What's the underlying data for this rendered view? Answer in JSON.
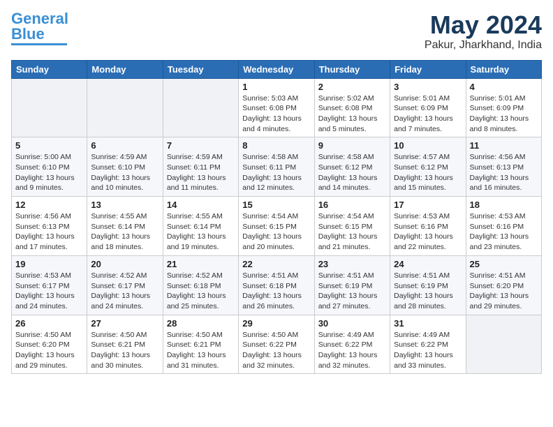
{
  "logo": {
    "line1": "General",
    "line2": "Blue"
  },
  "title": {
    "month_year": "May 2024",
    "location": "Pakur, Jharkhand, India"
  },
  "weekdays": [
    "Sunday",
    "Monday",
    "Tuesday",
    "Wednesday",
    "Thursday",
    "Friday",
    "Saturday"
  ],
  "weeks": [
    [
      {
        "day": "",
        "sunrise": "",
        "sunset": "",
        "daylight": ""
      },
      {
        "day": "",
        "sunrise": "",
        "sunset": "",
        "daylight": ""
      },
      {
        "day": "",
        "sunrise": "",
        "sunset": "",
        "daylight": ""
      },
      {
        "day": "1",
        "sunrise": "Sunrise: 5:03 AM",
        "sunset": "Sunset: 6:08 PM",
        "daylight": "Daylight: 13 hours and 4 minutes."
      },
      {
        "day": "2",
        "sunrise": "Sunrise: 5:02 AM",
        "sunset": "Sunset: 6:08 PM",
        "daylight": "Daylight: 13 hours and 5 minutes."
      },
      {
        "day": "3",
        "sunrise": "Sunrise: 5:01 AM",
        "sunset": "Sunset: 6:09 PM",
        "daylight": "Daylight: 13 hours and 7 minutes."
      },
      {
        "day": "4",
        "sunrise": "Sunrise: 5:01 AM",
        "sunset": "Sunset: 6:09 PM",
        "daylight": "Daylight: 13 hours and 8 minutes."
      }
    ],
    [
      {
        "day": "5",
        "sunrise": "Sunrise: 5:00 AM",
        "sunset": "Sunset: 6:10 PM",
        "daylight": "Daylight: 13 hours and 9 minutes."
      },
      {
        "day": "6",
        "sunrise": "Sunrise: 4:59 AM",
        "sunset": "Sunset: 6:10 PM",
        "daylight": "Daylight: 13 hours and 10 minutes."
      },
      {
        "day": "7",
        "sunrise": "Sunrise: 4:59 AM",
        "sunset": "Sunset: 6:11 PM",
        "daylight": "Daylight: 13 hours and 11 minutes."
      },
      {
        "day": "8",
        "sunrise": "Sunrise: 4:58 AM",
        "sunset": "Sunset: 6:11 PM",
        "daylight": "Daylight: 13 hours and 12 minutes."
      },
      {
        "day": "9",
        "sunrise": "Sunrise: 4:58 AM",
        "sunset": "Sunset: 6:12 PM",
        "daylight": "Daylight: 13 hours and 14 minutes."
      },
      {
        "day": "10",
        "sunrise": "Sunrise: 4:57 AM",
        "sunset": "Sunset: 6:12 PM",
        "daylight": "Daylight: 13 hours and 15 minutes."
      },
      {
        "day": "11",
        "sunrise": "Sunrise: 4:56 AM",
        "sunset": "Sunset: 6:13 PM",
        "daylight": "Daylight: 13 hours and 16 minutes."
      }
    ],
    [
      {
        "day": "12",
        "sunrise": "Sunrise: 4:56 AM",
        "sunset": "Sunset: 6:13 PM",
        "daylight": "Daylight: 13 hours and 17 minutes."
      },
      {
        "day": "13",
        "sunrise": "Sunrise: 4:55 AM",
        "sunset": "Sunset: 6:14 PM",
        "daylight": "Daylight: 13 hours and 18 minutes."
      },
      {
        "day": "14",
        "sunrise": "Sunrise: 4:55 AM",
        "sunset": "Sunset: 6:14 PM",
        "daylight": "Daylight: 13 hours and 19 minutes."
      },
      {
        "day": "15",
        "sunrise": "Sunrise: 4:54 AM",
        "sunset": "Sunset: 6:15 PM",
        "daylight": "Daylight: 13 hours and 20 minutes."
      },
      {
        "day": "16",
        "sunrise": "Sunrise: 4:54 AM",
        "sunset": "Sunset: 6:15 PM",
        "daylight": "Daylight: 13 hours and 21 minutes."
      },
      {
        "day": "17",
        "sunrise": "Sunrise: 4:53 AM",
        "sunset": "Sunset: 6:16 PM",
        "daylight": "Daylight: 13 hours and 22 minutes."
      },
      {
        "day": "18",
        "sunrise": "Sunrise: 4:53 AM",
        "sunset": "Sunset: 6:16 PM",
        "daylight": "Daylight: 13 hours and 23 minutes."
      }
    ],
    [
      {
        "day": "19",
        "sunrise": "Sunrise: 4:53 AM",
        "sunset": "Sunset: 6:17 PM",
        "daylight": "Daylight: 13 hours and 24 minutes."
      },
      {
        "day": "20",
        "sunrise": "Sunrise: 4:52 AM",
        "sunset": "Sunset: 6:17 PM",
        "daylight": "Daylight: 13 hours and 24 minutes."
      },
      {
        "day": "21",
        "sunrise": "Sunrise: 4:52 AM",
        "sunset": "Sunset: 6:18 PM",
        "daylight": "Daylight: 13 hours and 25 minutes."
      },
      {
        "day": "22",
        "sunrise": "Sunrise: 4:51 AM",
        "sunset": "Sunset: 6:18 PM",
        "daylight": "Daylight: 13 hours and 26 minutes."
      },
      {
        "day": "23",
        "sunrise": "Sunrise: 4:51 AM",
        "sunset": "Sunset: 6:19 PM",
        "daylight": "Daylight: 13 hours and 27 minutes."
      },
      {
        "day": "24",
        "sunrise": "Sunrise: 4:51 AM",
        "sunset": "Sunset: 6:19 PM",
        "daylight": "Daylight: 13 hours and 28 minutes."
      },
      {
        "day": "25",
        "sunrise": "Sunrise: 4:51 AM",
        "sunset": "Sunset: 6:20 PM",
        "daylight": "Daylight: 13 hours and 29 minutes."
      }
    ],
    [
      {
        "day": "26",
        "sunrise": "Sunrise: 4:50 AM",
        "sunset": "Sunset: 6:20 PM",
        "daylight": "Daylight: 13 hours and 29 minutes."
      },
      {
        "day": "27",
        "sunrise": "Sunrise: 4:50 AM",
        "sunset": "Sunset: 6:21 PM",
        "daylight": "Daylight: 13 hours and 30 minutes."
      },
      {
        "day": "28",
        "sunrise": "Sunrise: 4:50 AM",
        "sunset": "Sunset: 6:21 PM",
        "daylight": "Daylight: 13 hours and 31 minutes."
      },
      {
        "day": "29",
        "sunrise": "Sunrise: 4:50 AM",
        "sunset": "Sunset: 6:22 PM",
        "daylight": "Daylight: 13 hours and 32 minutes."
      },
      {
        "day": "30",
        "sunrise": "Sunrise: 4:49 AM",
        "sunset": "Sunset: 6:22 PM",
        "daylight": "Daylight: 13 hours and 32 minutes."
      },
      {
        "day": "31",
        "sunrise": "Sunrise: 4:49 AM",
        "sunset": "Sunset: 6:22 PM",
        "daylight": "Daylight: 13 hours and 33 minutes."
      },
      {
        "day": "",
        "sunrise": "",
        "sunset": "",
        "daylight": ""
      }
    ]
  ]
}
